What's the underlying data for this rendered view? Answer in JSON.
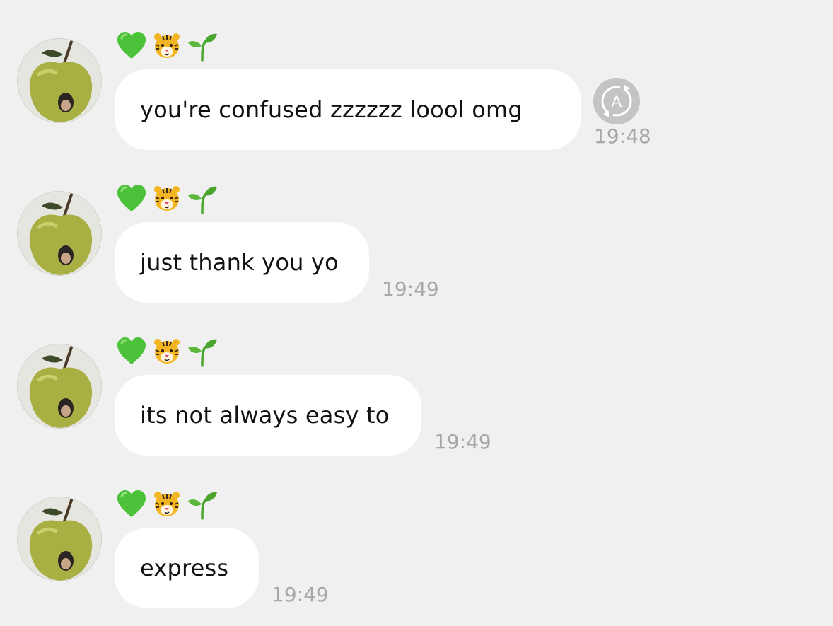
{
  "conversation": {
    "messages": [
      {
        "name_icons": [
          "green-heart-icon",
          "tiger-face-icon",
          "seedling-icon"
        ],
        "text": "you're confused zzzzzz loool omg",
        "time": "19:48",
        "has_translate_button": true,
        "translate_glyph": "A"
      },
      {
        "name_icons": [
          "green-heart-icon",
          "tiger-face-icon",
          "seedling-icon"
        ],
        "text": "just thank you yo",
        "time": "19:49",
        "has_translate_button": false
      },
      {
        "name_icons": [
          "green-heart-icon",
          "tiger-face-icon",
          "seedling-icon"
        ],
        "text": "its not always easy to",
        "time": "19:49",
        "has_translate_button": false
      },
      {
        "name_icons": [
          "green-heart-icon",
          "tiger-face-icon",
          "seedling-icon"
        ],
        "text": "express",
        "time": "19:49",
        "has_translate_button": false
      }
    ]
  },
  "colors": {
    "background": "#f0f0f0",
    "bubble": "#ffffff",
    "text": "#111111",
    "timestamp": "#a7a7a7",
    "translate_button": "#c4c4c4",
    "heart": "#4cc23a",
    "tiger": "#f3b522",
    "seedling": "#4aa52e",
    "avatar_apple": "#a9b043"
  }
}
